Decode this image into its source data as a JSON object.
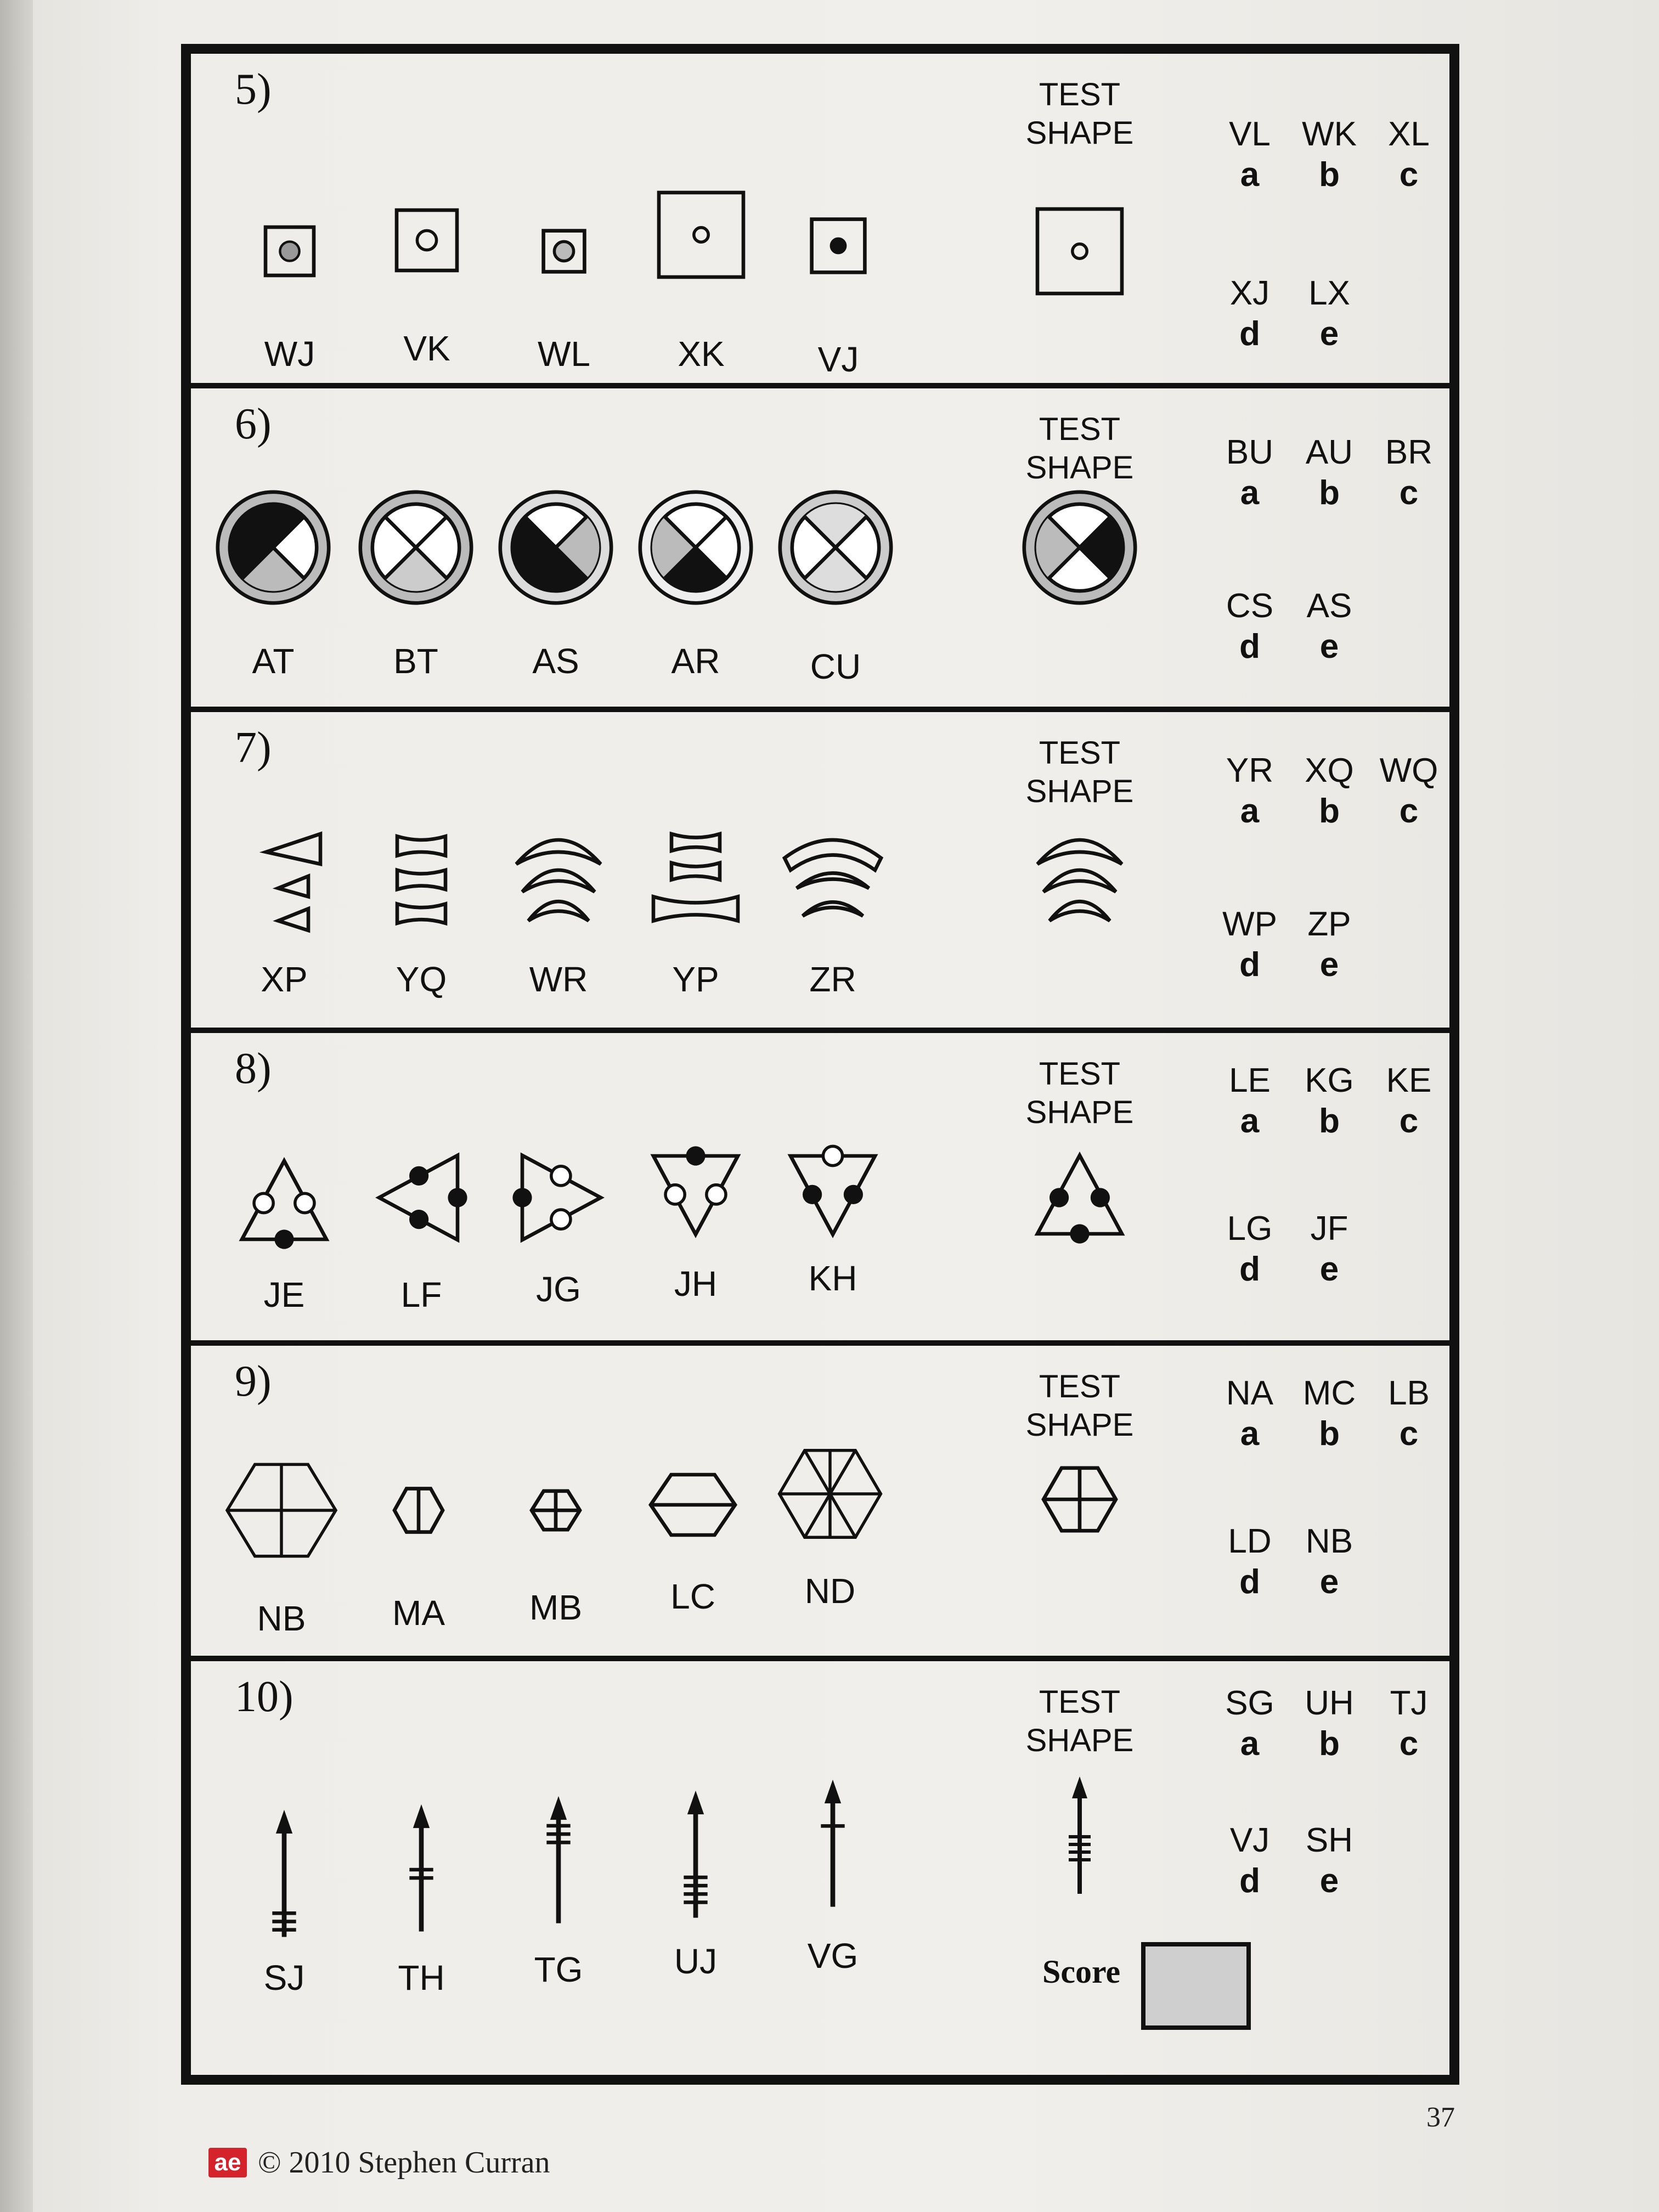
{
  "test_label_line1": "TEST",
  "test_label_line2": "SHAPE",
  "questions": [
    {
      "number": "5)",
      "labels": [
        "WJ",
        "VK",
        "WL",
        "XK",
        "VJ"
      ],
      "options": [
        {
          "code": "VL",
          "letter": "a"
        },
        {
          "code": "WK",
          "letter": "b"
        },
        {
          "code": "XL",
          "letter": "c"
        },
        {
          "code": "XJ",
          "letter": "d"
        },
        {
          "code": "LX",
          "letter": "e"
        }
      ]
    },
    {
      "number": "6)",
      "labels": [
        "AT",
        "BT",
        "AS",
        "AR",
        "CU"
      ],
      "options": [
        {
          "code": "BU",
          "letter": "a"
        },
        {
          "code": "AU",
          "letter": "b"
        },
        {
          "code": "BR",
          "letter": "c"
        },
        {
          "code": "CS",
          "letter": "d"
        },
        {
          "code": "AS",
          "letter": "e"
        }
      ]
    },
    {
      "number": "7)",
      "labels": [
        "XP",
        "YQ",
        "WR",
        "YP",
        "ZR"
      ],
      "options": [
        {
          "code": "YR",
          "letter": "a"
        },
        {
          "code": "XQ",
          "letter": "b"
        },
        {
          "code": "WQ",
          "letter": "c"
        },
        {
          "code": "WP",
          "letter": "d"
        },
        {
          "code": "ZP",
          "letter": "e"
        }
      ]
    },
    {
      "number": "8)",
      "labels": [
        "JE",
        "LF",
        "JG",
        "JH",
        "KH"
      ],
      "options": [
        {
          "code": "LE",
          "letter": "a"
        },
        {
          "code": "KG",
          "letter": "b"
        },
        {
          "code": "KE",
          "letter": "c"
        },
        {
          "code": "LG",
          "letter": "d"
        },
        {
          "code": "JF",
          "letter": "e"
        }
      ]
    },
    {
      "number": "9)",
      "labels": [
        "NB",
        "MA",
        "MB",
        "LC",
        "ND"
      ],
      "options": [
        {
          "code": "NA",
          "letter": "a"
        },
        {
          "code": "MC",
          "letter": "b"
        },
        {
          "code": "LB",
          "letter": "c"
        },
        {
          "code": "LD",
          "letter": "d"
        },
        {
          "code": "NB",
          "letter": "e"
        }
      ]
    },
    {
      "number": "10)",
      "labels": [
        "SJ",
        "TH",
        "TG",
        "UJ",
        "VG"
      ],
      "options": [
        {
          "code": "SG",
          "letter": "a"
        },
        {
          "code": "UH",
          "letter": "b"
        },
        {
          "code": "TJ",
          "letter": "c"
        },
        {
          "code": "VJ",
          "letter": "d"
        },
        {
          "code": "SH",
          "letter": "e"
        }
      ]
    }
  ],
  "score_label": "Score",
  "page_number": "37",
  "footer": {
    "logo_text": "ae",
    "copyright": "© 2010  Stephen Curran"
  },
  "colors": {
    "ink": "#111111",
    "shade": "#cfcfcf",
    "logo": "#d4232b"
  }
}
